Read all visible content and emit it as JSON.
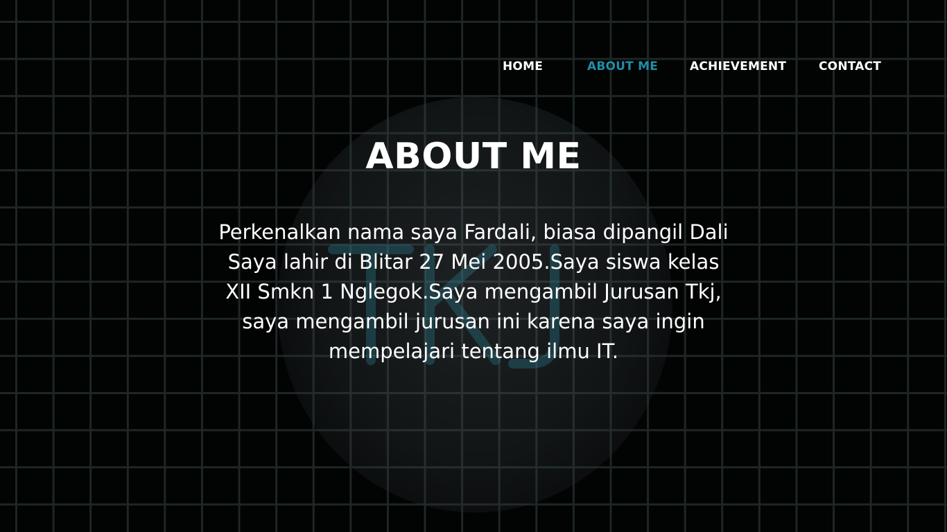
{
  "nav": {
    "items": [
      {
        "label": "HOME",
        "active": false
      },
      {
        "label": "ABOUT ME",
        "active": true
      },
      {
        "label": "ACHIEVEMENT",
        "active": false
      },
      {
        "label": "CONTACT",
        "active": false
      }
    ]
  },
  "main": {
    "title": "ABOUT ME",
    "bio_lines": [
      "Perkenalkan nama saya Fardali, biasa dipangil Dali",
      "Saya lahir di Blitar 27 Mei 2005.Saya siswa kelas",
      "XII Smkn 1 Nglegok.Saya mengambil Jurusan Tkj,",
      "saya mengambil jurusan ini karena saya ingin",
      "mempelajari tentang ilmu IT."
    ]
  },
  "colors": {
    "background": "#020303",
    "grid": "#1e2626",
    "text": "#ffffff",
    "accent": "#1f8fa8"
  }
}
